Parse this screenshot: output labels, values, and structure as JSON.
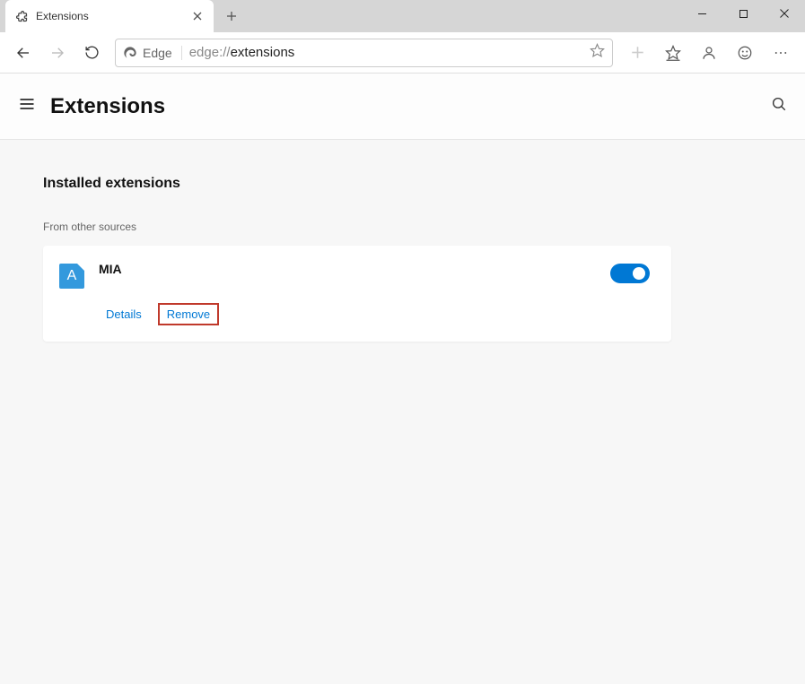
{
  "tab": {
    "title": "Extensions"
  },
  "addressbar": {
    "browser_label": "Edge",
    "url_prefix": "edge://",
    "url_path": "extensions"
  },
  "page": {
    "title": "Extensions",
    "section_title": "Installed extensions",
    "subsection_label": "From other sources"
  },
  "extension": {
    "name": "MIA",
    "icon_letter": "A",
    "details_label": "Details",
    "remove_label": "Remove",
    "enabled": true
  }
}
